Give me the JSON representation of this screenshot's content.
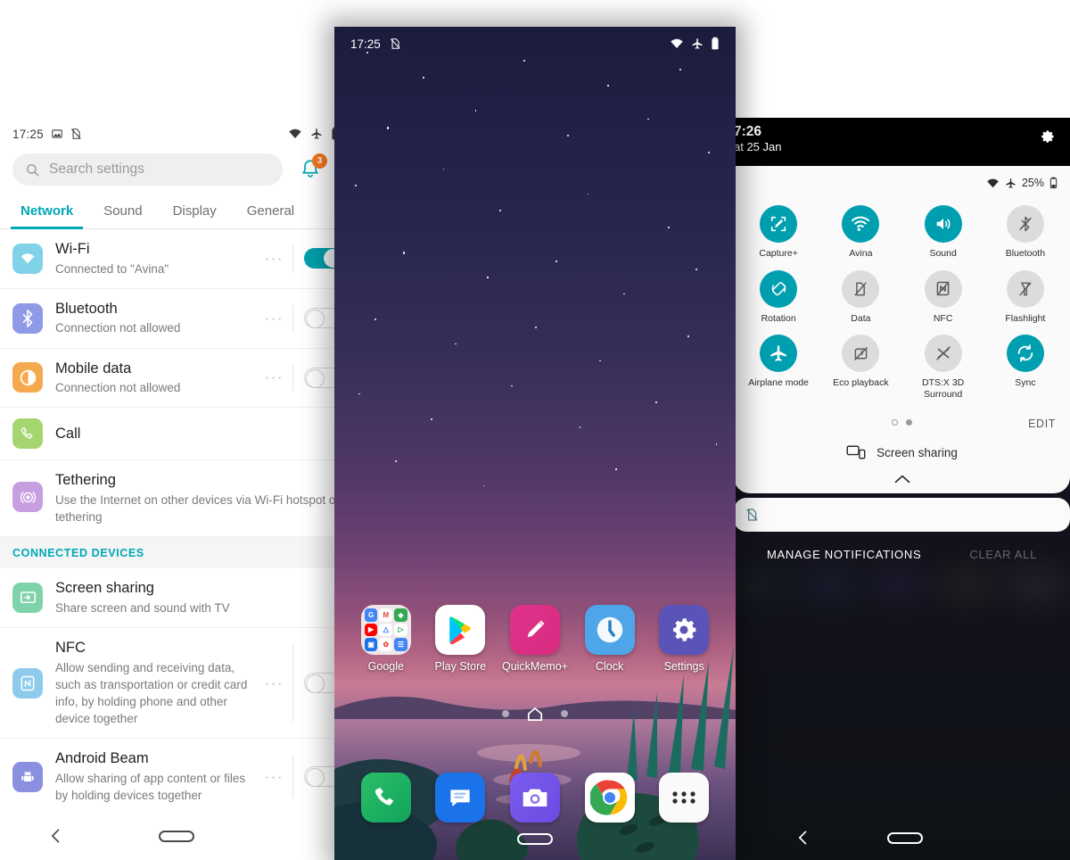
{
  "left_phone": {
    "status_bar": {
      "time": "17:25",
      "icons": [
        "image-icon",
        "no-sim-icon",
        "wifi-icon",
        "airplane-icon",
        "battery-icon"
      ]
    },
    "search": {
      "placeholder": "Search settings",
      "icon": "search-icon"
    },
    "notifications": {
      "icon": "bell-icon",
      "badge": "3"
    },
    "overflow": {
      "icon": "kebab-menu-icon"
    },
    "tabs": [
      {
        "label": "Network",
        "active": true
      },
      {
        "label": "Sound",
        "active": false
      },
      {
        "label": "Display",
        "active": false
      },
      {
        "label": "General",
        "active": false
      }
    ],
    "rows": [
      {
        "title": "Wi-Fi",
        "sub": "Connected to \"Avina\"",
        "icon": "wifi-icon",
        "icon_color": "#7fd2e8",
        "toggle": "on",
        "has_dots": true
      },
      {
        "title": "Bluetooth",
        "sub": "Connection not allowed",
        "icon": "bluetooth-icon",
        "icon_color": "#8f9ae6",
        "toggle": "off",
        "has_dots": true
      },
      {
        "title": "Mobile data",
        "sub": "Connection not allowed",
        "icon": "mobile-data-icon",
        "icon_color": "#f5a94e",
        "toggle": "off",
        "has_dots": true
      },
      {
        "title": "Call",
        "sub": "",
        "icon": "call-icon",
        "icon_color": "#a5d56e",
        "toggle": "none",
        "has_dots": false
      },
      {
        "title": "Tethering",
        "sub": "Use the Internet on other devices via Wi-Fi hotspot or tethering",
        "icon": "tethering-icon",
        "icon_color": "#c79fe0",
        "toggle": "none",
        "has_dots": false
      }
    ],
    "section_header": "CONNECTED DEVICES",
    "rows2": [
      {
        "title": "Screen sharing",
        "sub": "Share screen and sound with TV",
        "icon": "screen-share-icon",
        "icon_color": "#7fd3ab",
        "toggle": "none",
        "has_dots": false
      },
      {
        "title": "NFC",
        "sub": "Allow sending and receiving data, such as transportation or credit card info, by holding phone and other device together",
        "icon": "nfc-icon",
        "icon_color": "#8ecbea",
        "toggle": "off",
        "has_dots": true
      },
      {
        "title": "Android Beam",
        "sub": "Allow sharing of app content or files by holding devices together",
        "icon": "android-icon",
        "icon_color": "#8b8fe0",
        "toggle": "off",
        "has_dots": true
      }
    ],
    "navbar": {
      "back": "back-icon",
      "home": "home-pill-icon"
    },
    "accent_color": "#00a7b5",
    "toggle_on_color": "#00a0ad",
    "badge_color": "#f4751f"
  },
  "center_phone": {
    "status_bar": {
      "time": "17:25",
      "icons": [
        "no-sim-icon",
        "wifi-icon",
        "airplane-icon",
        "battery-icon"
      ]
    },
    "apps_row1": [
      {
        "label": "Google",
        "icon": "google-folder-icon"
      },
      {
        "label": "Play Store",
        "icon": "play-store-icon"
      },
      {
        "label": "QuickMemo+",
        "icon": "quickmemo-icon"
      },
      {
        "label": "Clock",
        "icon": "clock-icon"
      },
      {
        "label": "Settings",
        "icon": "settings-gear-icon"
      }
    ],
    "page_indicator": {
      "dots": 2,
      "home_icon": "home-icon"
    },
    "dock": [
      {
        "label": "Phone",
        "icon": "phone-icon"
      },
      {
        "label": "Messages",
        "icon": "messages-icon"
      },
      {
        "label": "Camera",
        "icon": "camera-icon"
      },
      {
        "label": "Chrome",
        "icon": "chrome-icon"
      },
      {
        "label": "App drawer",
        "icon": "app-drawer-icon"
      }
    ],
    "navbar": {
      "home": "home-pill-icon"
    }
  },
  "right_phone": {
    "clock": {
      "time": "7:26",
      "date": "at 25 Jan"
    },
    "settings_gear": "gear-icon",
    "status_bar": {
      "wifi": "wifi-icon",
      "airplane": "airplane-icon",
      "battery_pct": "25%",
      "battery": "battery-icon"
    },
    "tiles": [
      {
        "label": "Capture+",
        "icon": "capture-plus-icon",
        "state": "on"
      },
      {
        "label": "Avina",
        "icon": "wifi-icon",
        "state": "on"
      },
      {
        "label": "Sound",
        "icon": "sound-icon",
        "state": "on"
      },
      {
        "label": "Bluetooth",
        "icon": "bluetooth-off-icon",
        "state": "off"
      },
      {
        "label": "Rotation",
        "icon": "rotation-icon",
        "state": "on"
      },
      {
        "label": "Data",
        "icon": "data-off-icon",
        "state": "off"
      },
      {
        "label": "NFC",
        "icon": "nfc-off-icon",
        "state": "off"
      },
      {
        "label": "Flashlight",
        "icon": "flashlight-off-icon",
        "state": "off"
      },
      {
        "label": "Airplane mode",
        "icon": "airplane-icon",
        "state": "on"
      },
      {
        "label": "Eco playback",
        "icon": "eco-playback-off-icon",
        "state": "off"
      },
      {
        "label": "DTS:X 3D Surround",
        "icon": "dtsx-off-icon",
        "state": "off"
      },
      {
        "label": "Sync",
        "icon": "sync-icon",
        "state": "on"
      }
    ],
    "edit_label": "EDIT",
    "screen_sharing": {
      "label": "Screen sharing",
      "icon": "screen-share-icon"
    },
    "collapse_icon": "chevron-up-icon",
    "manage_notifications": "MANAGE NOTIFICATIONS",
    "clear_all": "CLEAR ALL",
    "navbar": {
      "back": "back-icon",
      "home": "home-pill-icon"
    },
    "accent_color": "#009fb0"
  }
}
